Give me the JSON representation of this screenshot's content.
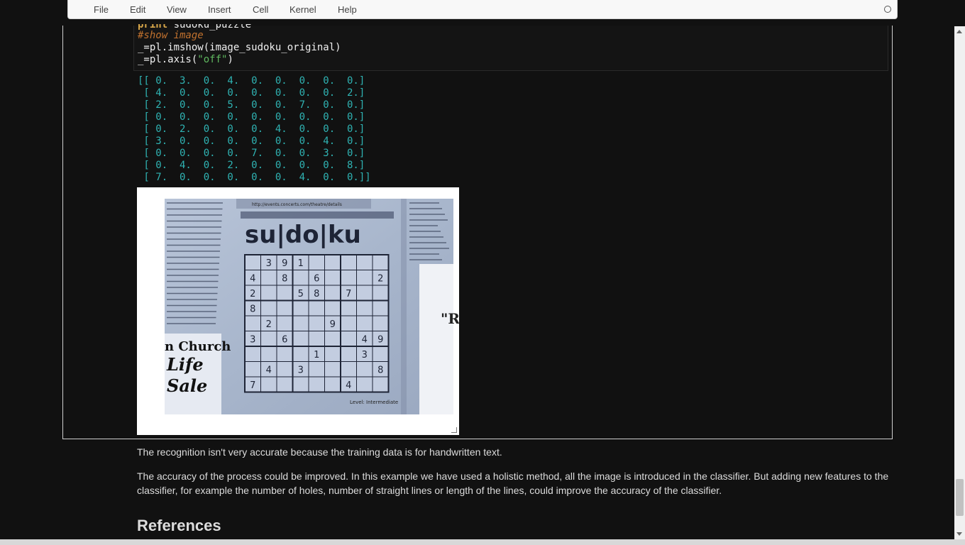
{
  "menubar": {
    "items": [
      "File",
      "Edit",
      "View",
      "Insert",
      "Cell",
      "Kernel",
      "Help"
    ]
  },
  "code": {
    "line0": "print sudoku_puzzle",
    "line1": "#show image",
    "line2_pre": "_=pl.imshow(image_sudoku_original)",
    "line3_pre": "_=pl.axis(",
    "line3_str": "\"off\"",
    "line3_post": ")"
  },
  "output": {
    "rows": [
      "[[ 0.  3.  0.  4.  0.  0.  0.  0.  0.]",
      " [ 4.  0.  0.  0.  0.  0.  0.  0.  2.]",
      " [ 2.  0.  0.  5.  0.  0.  7.  0.  0.]",
      " [ 0.  0.  0.  0.  0.  0.  0.  0.  0.]",
      " [ 0.  2.  0.  0.  0.  4.  0.  0.  0.]",
      " [ 3.  0.  0.  0.  0.  0.  0.  4.  0.]",
      " [ 0.  0.  0.  0.  7.  0.  0.  3.  0.]",
      " [ 0.  4.  0.  2.  0.  0.  0.  0.  8.]",
      " [ 7.  0.  0.  0.  0.  0.  4.  0.  0.]]"
    ]
  },
  "photo": {
    "logo": "su|do|ku",
    "grid": [
      [
        "",
        "3",
        "9",
        "1",
        "",
        "",
        "",
        "",
        ""
      ],
      [
        "4",
        "",
        "8",
        "",
        "6",
        "",
        "",
        "",
        "2"
      ],
      [
        "2",
        "",
        "",
        "5",
        "8",
        "",
        "7",
        "",
        ""
      ],
      [
        "8",
        "",
        "",
        "",
        "",
        "",
        "",
        "",
        ""
      ],
      [
        "",
        "2",
        "",
        "",
        "",
        "9",
        "",
        "",
        ""
      ],
      [
        "3",
        "",
        "6",
        "",
        "",
        "",
        "",
        "4",
        "9"
      ],
      [
        "",
        "",
        "",
        "",
        "1",
        "",
        "",
        "3",
        ""
      ],
      [
        "",
        "4",
        "",
        "3",
        "",
        "",
        "",
        "",
        "8"
      ],
      [
        "7",
        "",
        "",
        "",
        "",
        "",
        "4",
        "",
        ""
      ]
    ],
    "church_text": [
      "n Church",
      "Life",
      "Sale"
    ],
    "level_text": "Level: Intermediate",
    "url_text": "http://events.concerts.com/theatre/details",
    "right_letters": "\"R"
  },
  "markdown": {
    "p1": "The recognition isn't very accurate because the training data is for handwritten text.",
    "p2": "The accuracy of the process could be improved. In this example we have used a holistic method, all the image is introduced in the classifier. But adding new features to the classifier, for example the number of holes, number of straight lines or length of the lines, could improve the accuracy of the classifier.",
    "heading": "References"
  }
}
